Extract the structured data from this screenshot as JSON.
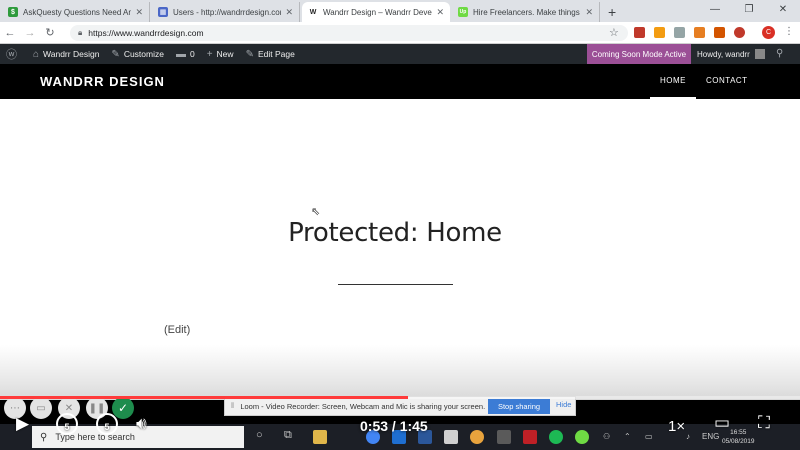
{
  "browser": {
    "tabs": [
      {
        "label": "AskQuesty Questions Need Answ",
        "fav": "$",
        "color": "#2e9b3c"
      },
      {
        "label": "Users - http://wandrrdesign.com",
        "fav": "▦",
        "color": "#4a67c7"
      },
      {
        "label": "Wandrr Design – Wandrr Develop",
        "fav": "W",
        "color": "#222222"
      },
      {
        "label": "Hire Freelancers. Make things ha",
        "fav": "Up",
        "color": "#6fda44"
      }
    ],
    "url": "https://www.wandrrdesign.com",
    "profile_initial": "C"
  },
  "adminbar": {
    "site_name": "Wandrr Design",
    "customize": "Customize",
    "comments": "0",
    "new": "New",
    "edit_page": "Edit Page",
    "coming_soon": "Coming Soon Mode Active",
    "howdy": "Howdy, wandrr"
  },
  "site": {
    "title": "WANDRR DESIGN",
    "menu": [
      {
        "label": "HOME",
        "current": true
      },
      {
        "label": "CONTACT",
        "current": false
      }
    ]
  },
  "page": {
    "title": "Protected: Home",
    "edit_link": "(Edit)"
  },
  "loom": {
    "message": "Loom - Video Recorder: Screen, Webcam and Mic is sharing your screen.",
    "stop_label": "Stop sharing",
    "hide_label": "Hide"
  },
  "taskbar": {
    "search_placeholder": "Type here to search",
    "language": "ENG",
    "time": "16:55",
    "date": "05/08/2019"
  },
  "player": {
    "progress": 0.51,
    "time_display": "0:53 / 1:45",
    "speed": "1×",
    "skip_back_seconds": "5",
    "skip_forward_seconds": "5"
  }
}
